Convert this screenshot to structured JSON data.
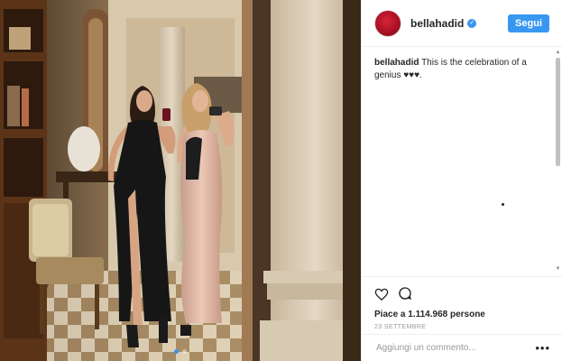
{
  "post": {
    "username": "bellahadid",
    "follow_label": "Segui",
    "caption_user": "bellahadid",
    "caption_text": "This is the celebration of a genius ♥♥♥.",
    "likes_text": "Piace a 1.114.968 persone",
    "date_text": "23 SETTEMBRE",
    "comment_placeholder": "Aggiungi un commento...",
    "more_label": "•••"
  },
  "carousel": {
    "total": 2,
    "active": 1
  },
  "icons": [
    "heart-icon",
    "comment-icon",
    "verified-badge-icon",
    "more-options-icon"
  ],
  "colors": {
    "accent": "#3897f0",
    "text": "#262626",
    "muted": "#999999",
    "border": "#efefef"
  }
}
